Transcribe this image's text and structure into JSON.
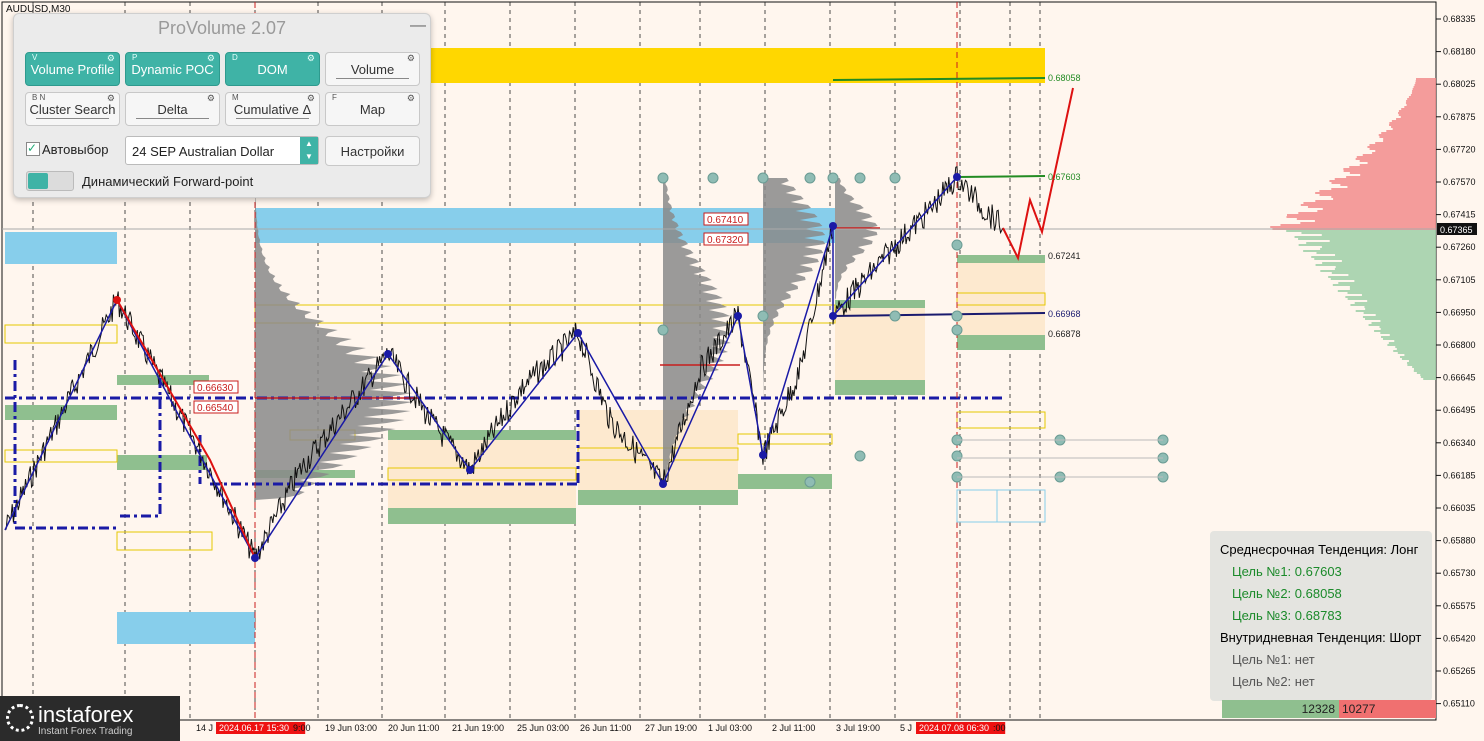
{
  "symbol": "AUDUSD,M30",
  "panel": {
    "title": "ProVolume 2.07",
    "buttons": [
      {
        "label": "Volume Profile",
        "tag": "V",
        "active": true
      },
      {
        "label": "Dynamic POC",
        "tag": "P",
        "active": true
      },
      {
        "label": "DOM",
        "tag": "D",
        "active": true
      },
      {
        "label": "Volume",
        "tag": "",
        "active": false
      },
      {
        "label": "Cluster Search",
        "tag": "B N",
        "active": false
      },
      {
        "label": "Delta",
        "tag": "",
        "active": false
      },
      {
        "label": "Cumulative Δ",
        "tag": "M",
        "active": false
      },
      {
        "label": "Map",
        "tag": "F",
        "active": false
      }
    ],
    "autoselect_label": "Автовыбор",
    "autoselect_checked": true,
    "instrument": "24 SEP Australian Dollar",
    "settings_label": "Настройки",
    "forward_point_label": "Динамический Forward-point"
  },
  "price_axis": [
    "0.68335",
    "0.68180",
    "0.68025",
    "0.67875",
    "0.67720",
    "0.67570",
    "0.67415",
    "0.67260",
    "0.67105",
    "0.66950",
    "0.66800",
    "0.66645",
    "0.66495",
    "0.66340",
    "0.66185",
    "0.66035",
    "0.65880",
    "0.65730",
    "0.65575",
    "0.65420",
    "0.65265",
    "0.65110"
  ],
  "current_price": "0.67365",
  "price_labels": {
    "target3": "0.68058",
    "target1": "0.67603",
    "level_a": "0.67241",
    "level_b": "0.66968",
    "level_c": "0.66878",
    "box_a": "0.67410",
    "box_b": "0.67320",
    "box_c": "0.66630",
    "box_d": "0.66540"
  },
  "time_axis": [
    "14 J",
    "2024.06.17 15:30",
    "9:00",
    "19 Jun 03:00",
    "20 Jun 11:00",
    "21 Jun 19:00",
    "25 Jun 03:00",
    "26 Jun 11:00",
    "27 Jun 19:00",
    "1 Jul 03:00",
    "2 Jul 11:00",
    "3 Jul 19:00",
    "5 J",
    "2024.07.08 06:30",
    ":00"
  ],
  "info": {
    "mid_trend": "Среднесрочная Тенденция: Лонг",
    "target1": "Цель №1: 0.67603",
    "target2": "Цель №2: 0.68058",
    "target3": "Цель №3: 0.68783",
    "intraday_trend": "Внутридневная Тенденция: Шорт",
    "intraday_target1": "Цель №1: нет",
    "intraday_target2": "Цель №2: нет"
  },
  "volumes": {
    "buy": "12328",
    "sell": "10277"
  },
  "logo": {
    "name": "instaforex",
    "sub": "Instant Forex Trading"
  },
  "colors": {
    "background": "#fff6ee",
    "bull_zone": "#8fbf8f",
    "bear_zone": "#f7b0aa",
    "gold_zone": "#ffd700",
    "blue_zone": "#87ceeb",
    "zigzag": "#1a1aa6",
    "forecast": "#dd1111"
  }
}
